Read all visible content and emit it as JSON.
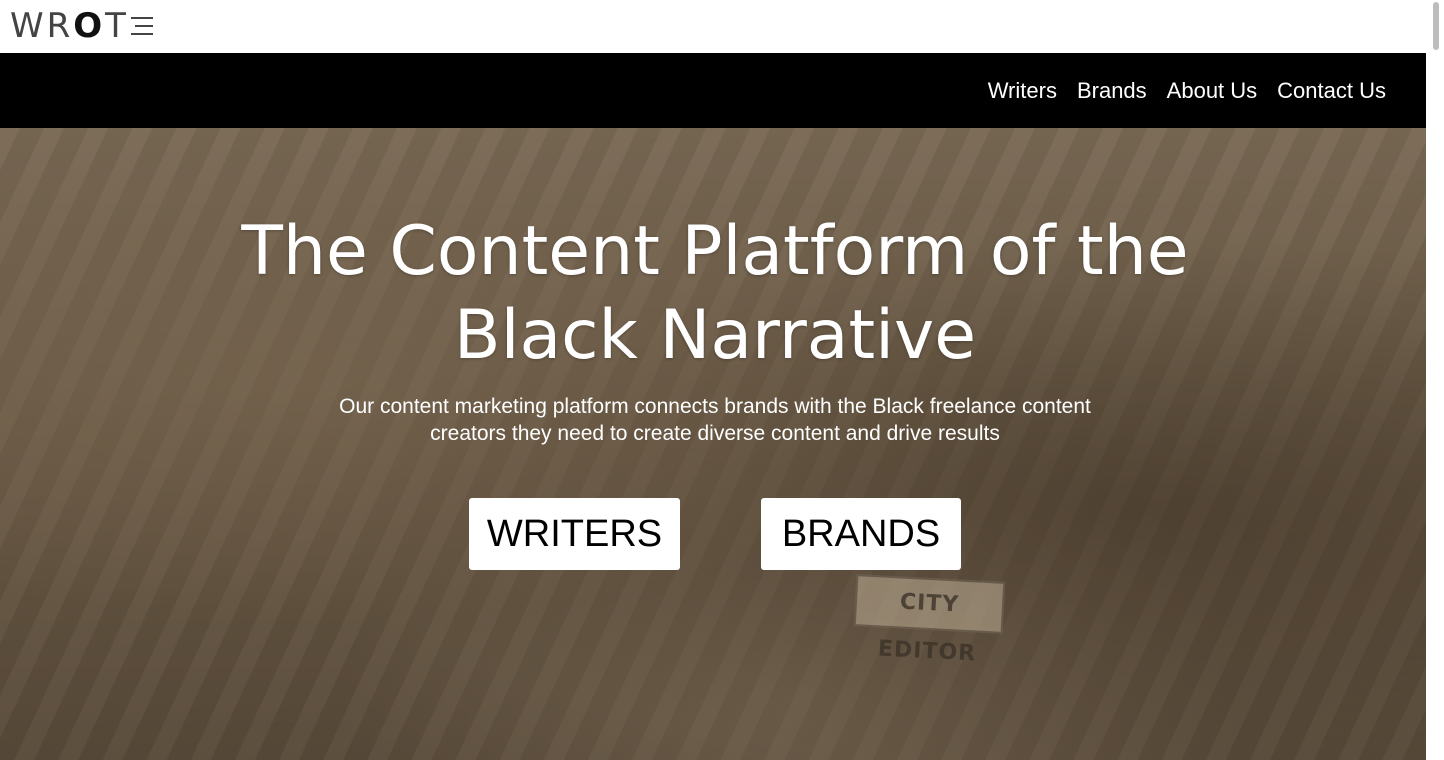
{
  "brand": {
    "logo_text": "WROTE"
  },
  "nav": {
    "items": [
      {
        "label": "Writers"
      },
      {
        "label": "Brands"
      },
      {
        "label": "About Us"
      },
      {
        "label": "Contact Us"
      }
    ]
  },
  "hero": {
    "title_line1": "The Content Platform of the",
    "title_line2": "Black Narrative",
    "subtitle_line1": "Our content marketing platform connects brands with the Black freelance content",
    "subtitle_line2": "creators they need to create diverse content and drive results",
    "background_sign": "CITY EDITOR",
    "cta_writers": "WRITERS",
    "cta_brands": "BRANDS"
  },
  "colors": {
    "nav_background": "#000000",
    "hero_tint": "#766650",
    "cta_background": "#ffffff",
    "text_light": "#ffffff"
  }
}
